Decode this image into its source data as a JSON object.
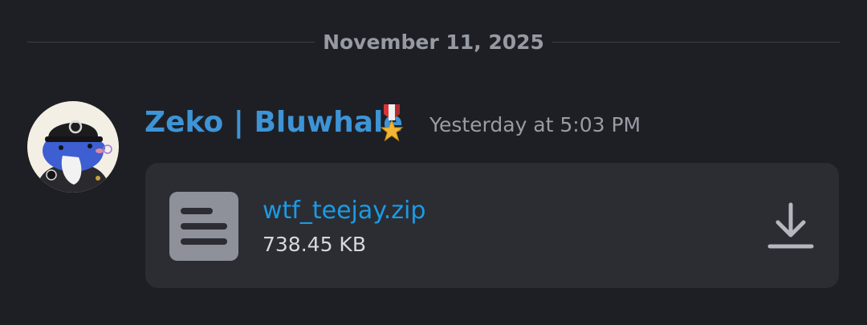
{
  "divider": {
    "date": "November 11, 2025"
  },
  "message": {
    "username": "Zeko | Bluwhale",
    "badge_icon": "medal-icon",
    "timestamp": "Yesterday at 5:03 PM",
    "avatar_icon": "avatar-whale-cap"
  },
  "attachment": {
    "file_name": "wtf_teejay.zip",
    "file_size": "738.45 KB",
    "file_icon": "file-text-icon",
    "download_icon": "download-icon"
  },
  "colors": {
    "background": "#1e1f24",
    "card": "#2b2d33",
    "username": "#3d94d6",
    "link": "#1a9be6",
    "muted": "#989ca5"
  }
}
